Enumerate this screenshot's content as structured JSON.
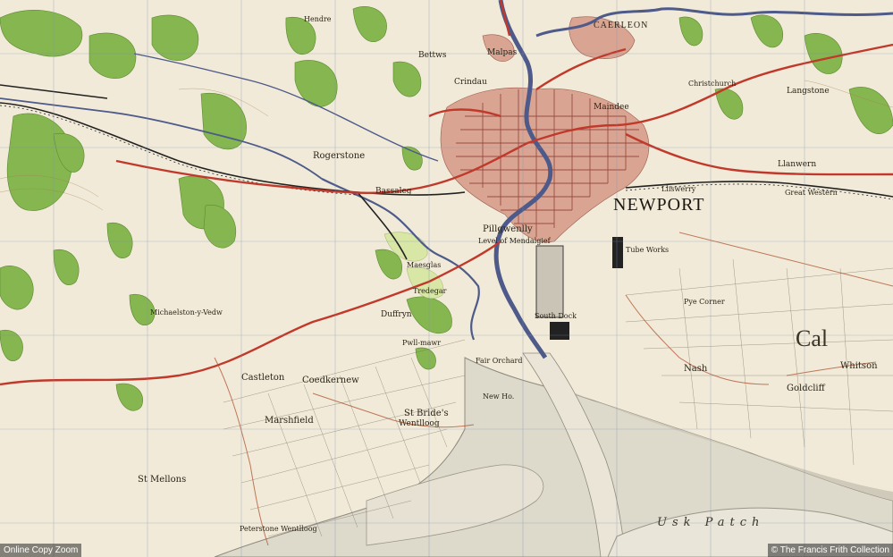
{
  "map": {
    "place_labels": {
      "newport": "NEWPORT",
      "caerleon": "CAERLEON",
      "pillgwenlly": "Pillgwenlly",
      "rogerstone": "Rogerstone",
      "castleton": "Castleton",
      "marshfield": "Marshfield",
      "st_brides": "St Bride's",
      "wentlloog": "Wentlloog",
      "nash": "Nash",
      "goldcliff": "Goldcliff",
      "whitson": "Whitson",
      "st_mellons": "St Mellons",
      "coedkernew": "Coedkernew",
      "bettws": "Bettws",
      "malpas": "Malpas",
      "crindau": "Crindau",
      "maindee": "Maindee",
      "bassaleg": "Bassaleg",
      "michaelston_y_vedw": "Michaelston-y-Vedw",
      "duffryn": "Duffryn",
      "maesglas": "Maesglas",
      "tredegar": "Tredegar",
      "peterstone": "Peterstone Wentlloog",
      "hendre": "Hendre",
      "llanwern": "Llanwern",
      "langstone": "Langstone",
      "christchurch": "Christchurch",
      "pye_corner": "Pye Corner",
      "pwll_mawr": "Pwll-mawr",
      "fair_orchard": "Fair Orchard",
      "new_house": "New Ho.",
      "south_dock": "South Dock",
      "tube_works": "Tube Works",
      "level_of_mendalgief": "Level of Mendalgief",
      "great_western": "Great Western",
      "lliswerry": "Lliswerry",
      "usk_patch": "Usk Patch",
      "caldicot_letter": "Cal"
    }
  },
  "footer": {
    "left": "Online Copy Zoom",
    "right": "© The Francis Frith Collection"
  },
  "colors": {
    "paper": "#f1ead8",
    "woodland": "#7fb04a",
    "urban": "#b9655a",
    "river": "#4d5a8a",
    "road": "#c0392b",
    "mudflat": "#d9d5c7",
    "grid": "#7d8fb5"
  }
}
